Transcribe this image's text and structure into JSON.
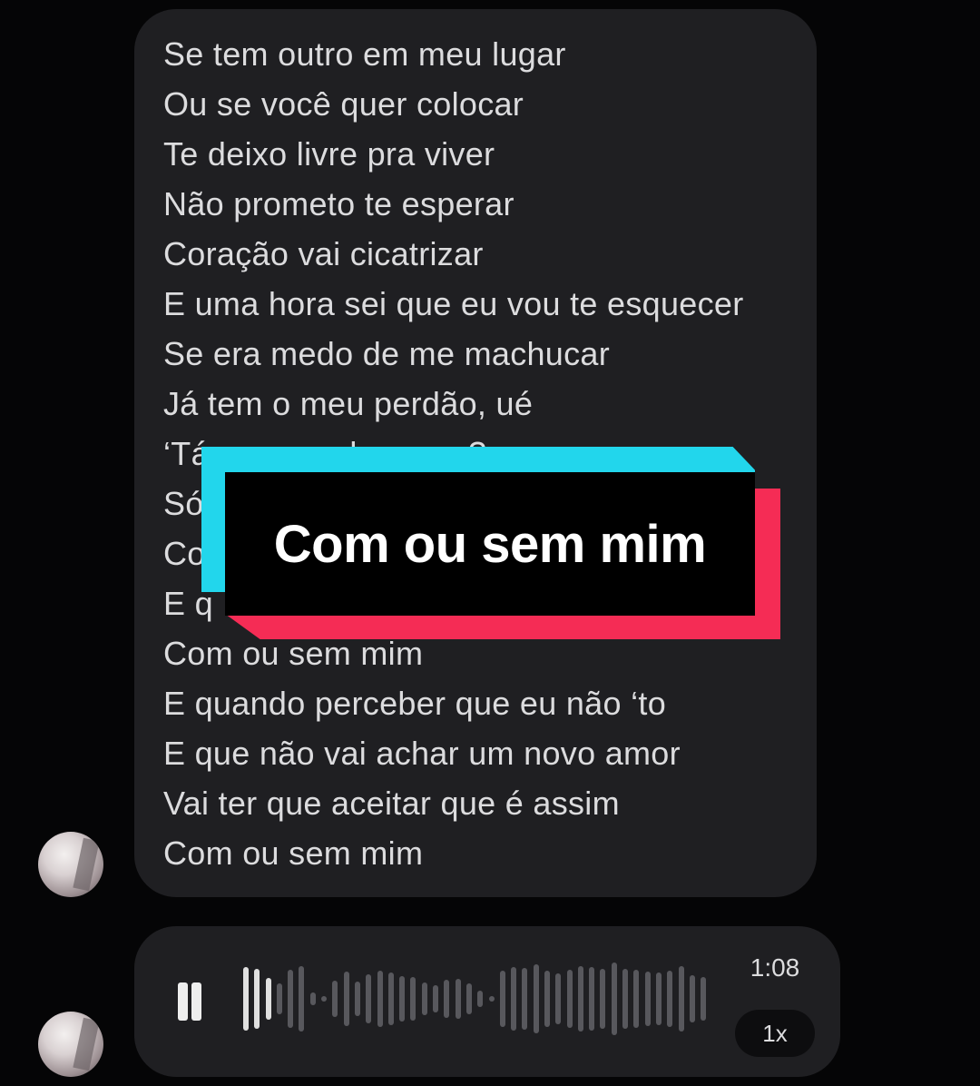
{
  "lyrics": {
    "lines": [
      "Se tem outro em meu lugar",
      "Ou se você quer colocar",
      "Te deixo livre pra viver",
      "Não prometo te esperar",
      "Coração vai cicatrizar",
      "E uma hora sei que eu vou te esquecer",
      "Se era medo de me machucar",
      "Já tem o meu perdão, ué",
      "‘Tá esperando o que?",
      "Só",
      "Co",
      "E q",
      "Com ou sem mim",
      "E quando perceber que eu não ‘to",
      "E que não vai achar um novo amor",
      "Vai ter que aceitar que é assim",
      "Com ou sem mim"
    ]
  },
  "caption": {
    "text": "Com ou sem mim",
    "colors": {
      "cyan": "#22d6ec",
      "red": "#f52c55",
      "box": "#000000"
    }
  },
  "voice_message": {
    "duration": "1:08",
    "speed": "1x",
    "pause_icon": "pause-icon",
    "progress_fraction": 0.07,
    "played_color": "#e0e0e0",
    "unplayed_color": "#58585d"
  }
}
